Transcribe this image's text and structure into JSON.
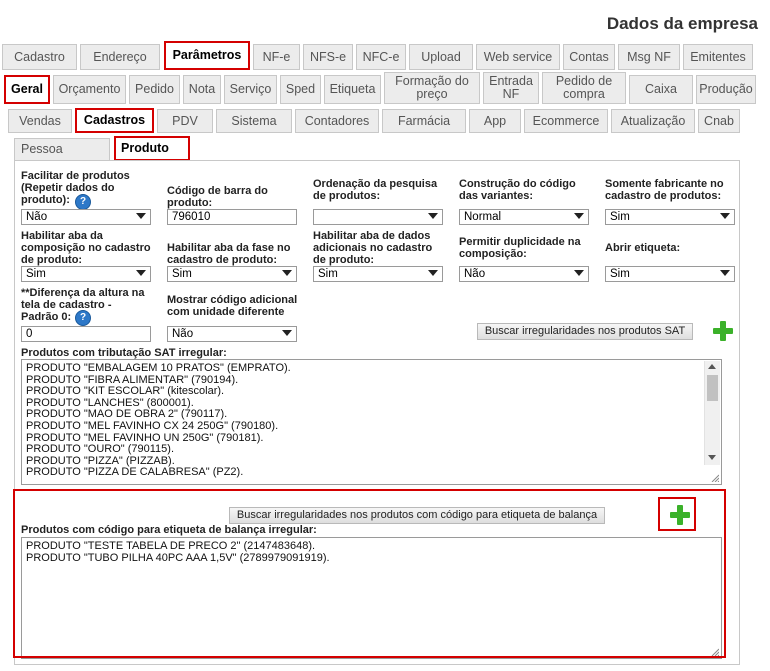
{
  "page": {
    "title": "Dados da empresa"
  },
  "tabs_main": [
    "Cadastro",
    "Endereço",
    "Parâmetros",
    "NF-e",
    "NFS-e",
    "NFC-e",
    "Upload",
    "Web service",
    "Contas",
    "Msg NF",
    "Emitentes"
  ],
  "tabs_params": [
    "Geral",
    "Orçamento",
    "Pedido",
    "Nota",
    "Serviço",
    "Sped",
    "Etiqueta",
    "Formação do preço",
    "Entrada NF",
    "Pedido de compra",
    "Caixa",
    "Produção"
  ],
  "tabs_geral": [
    "Vendas",
    "Cadastros",
    "PDV",
    "Sistema",
    "Contadores",
    "Farmácia",
    "App",
    "Ecommerce",
    "Atualização",
    "Cnab"
  ],
  "tabs_cadastros": [
    "Pessoa",
    "Produto"
  ],
  "fields": {
    "facilitar_label": "Facilitar de produtos (Repetir dados do produto):",
    "facilitar_value": "Não",
    "codigo_barra_label": "Código de barra do produto:",
    "codigo_barra_value": "796010",
    "ordenacao_label": "Ordenação da pesquisa de produtos:",
    "ordenacao_value": "",
    "construcao_label": "Construção do código das variantes:",
    "construcao_value": "Normal",
    "somente_fab_label": "Somente fabricante no cadastro de produtos:",
    "somente_fab_value": "Sim",
    "aba_composicao_label": "Habilitar aba da composição no cadastro de produto:",
    "aba_composicao_value": "Sim",
    "aba_fase_label": "Habilitar aba da fase no cadastro de produto:",
    "aba_fase_value": "Sim",
    "aba_dados_label": "Habilitar aba de dados adicionais no cadastro de produto:",
    "aba_dados_value": "Sim",
    "duplicidade_label": "Permitir duplicidade na composição:",
    "duplicidade_value": "Não",
    "abrir_etiqueta_label": "Abrir etiqueta:",
    "abrir_etiqueta_value": "Sim",
    "diferenca_altura_label": "**Diferença da altura na tela de cadastro - Padrão 0:",
    "diferenca_altura_value": "0",
    "codigo_adicional_label": "Mostrar código adicional com unidade diferente",
    "codigo_adicional_value": "Não",
    "help_symbol": "?"
  },
  "sat": {
    "button": "Buscar irregularidades nos produtos SAT",
    "label": "Produtos com tributação SAT irregular:",
    "lines": [
      "PRODUTO \"EMBALAGEM 10 PRATOS\" (EMPRATO).",
      "PRODUTO \"FIBRA ALIMENTAR\" (790194).",
      "PRODUTO \"KIT ESCOLAR\" (kitescolar).",
      "PRODUTO \"LANCHES\" (800001).",
      "PRODUTO \"MAO DE OBRA 2\" (790117).",
      "PRODUTO \"MEL FAVINHO CX 24 250G\" (790180).",
      "PRODUTO \"MEL FAVINHO UN 250G\" (790181).",
      "PRODUTO \"OURO\" (790115).",
      "PRODUTO \"PIZZA\" (PIZZAB).",
      "PRODUTO \"PIZZA DE CALABRESA\" (PZ2)."
    ]
  },
  "balanca": {
    "button": "Buscar irregularidades nos produtos com código para etiqueta de balança",
    "label": "Produtos com código para etiqueta de balança irregular:",
    "lines": [
      "PRODUTO \"TESTE TABELA DE PRECO 2\" (2147483648).",
      "PRODUTO \"TUBO PILHA 40PC AAA 1,5V\" (2789979091919)."
    ]
  },
  "icons": {
    "add": "plus-icon",
    "help": "help-icon",
    "dropdown": "chevron-down-icon"
  },
  "colors": {
    "highlight": "#d40000",
    "add_icon": "#3bb12a",
    "help_icon": "#2d78c8"
  }
}
